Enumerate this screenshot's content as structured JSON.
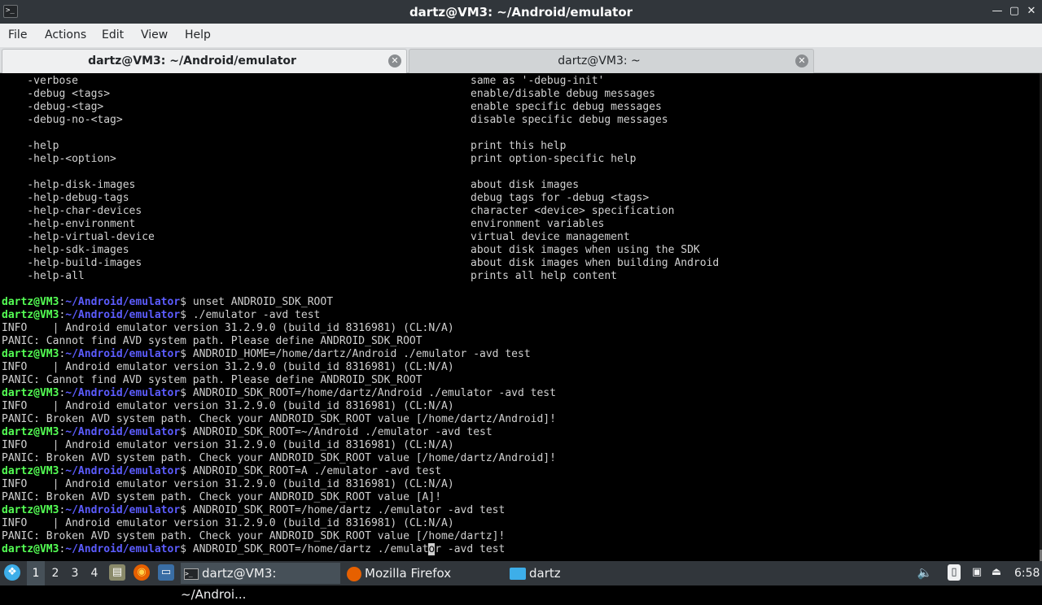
{
  "window": {
    "title": "dartz@VM3: ~/Android/emulator",
    "app_icon": "terminal-icon",
    "controls": [
      "minimize-icon",
      "maximize-icon",
      "close-icon"
    ],
    "control_glyphs": [
      "—",
      "▢",
      "✕"
    ]
  },
  "menu": [
    "File",
    "Actions",
    "Edit",
    "View",
    "Help"
  ],
  "tabs": [
    {
      "label": "dartz@VM3: ~/Android/emulator",
      "active": true
    },
    {
      "label": "dartz@VM3: ~",
      "active": false
    }
  ],
  "help_lines": [
    {
      "opt": "    -verbose",
      "desc": "same as '-debug-init'"
    },
    {
      "opt": "    -debug <tags>",
      "desc": "enable/disable debug messages"
    },
    {
      "opt": "    -debug-<tag>",
      "desc": "enable specific debug messages"
    },
    {
      "opt": "    -debug-no-<tag>",
      "desc": "disable specific debug messages"
    },
    {
      "opt": "",
      "desc": ""
    },
    {
      "opt": "    -help",
      "desc": "print this help"
    },
    {
      "opt": "    -help-<option>",
      "desc": "print option-specific help"
    },
    {
      "opt": "",
      "desc": ""
    },
    {
      "opt": "    -help-disk-images",
      "desc": "about disk images"
    },
    {
      "opt": "    -help-debug-tags",
      "desc": "debug tags for -debug <tags>"
    },
    {
      "opt": "    -help-char-devices",
      "desc": "character <device> specification"
    },
    {
      "opt": "    -help-environment",
      "desc": "environment variables"
    },
    {
      "opt": "    -help-virtual-device",
      "desc": "virtual device management"
    },
    {
      "opt": "    -help-sdk-images",
      "desc": "about disk images when using the SDK"
    },
    {
      "opt": "    -help-build-images",
      "desc": "about disk images when building Android"
    },
    {
      "opt": "    -help-all",
      "desc": "prints all help content"
    }
  ],
  "prompt": {
    "user_host": "dartz@VM3",
    "path": "~/Android/emulator",
    "symbol": "$ "
  },
  "session_lines": [
    {
      "type": "prompt",
      "cmd": "unset ANDROID_SDK_ROOT"
    },
    {
      "type": "prompt",
      "cmd": "./emulator -avd test"
    },
    {
      "type": "out",
      "text": "INFO    | Android emulator version 31.2.9.0 (build_id 8316981) (CL:N/A)"
    },
    {
      "type": "out",
      "text": "PANIC: Cannot find AVD system path. Please define ANDROID_SDK_ROOT"
    },
    {
      "type": "prompt",
      "cmd": "ANDROID_HOME=/home/dartz/Android ./emulator -avd test"
    },
    {
      "type": "out",
      "text": "INFO    | Android emulator version 31.2.9.0 (build_id 8316981) (CL:N/A)"
    },
    {
      "type": "out",
      "text": "PANIC: Cannot find AVD system path. Please define ANDROID_SDK_ROOT"
    },
    {
      "type": "prompt",
      "cmd": "ANDROID_SDK_ROOT=/home/dartz/Android ./emulator -avd test"
    },
    {
      "type": "out",
      "text": "INFO    | Android emulator version 31.2.9.0 (build_id 8316981) (CL:N/A)"
    },
    {
      "type": "out",
      "text": "PANIC: Broken AVD system path. Check your ANDROID_SDK_ROOT value [/home/dartz/Android]!"
    },
    {
      "type": "prompt",
      "cmd": "ANDROID_SDK_ROOT=~/Android ./emulator -avd test"
    },
    {
      "type": "out",
      "text": "INFO    | Android emulator version 31.2.9.0 (build_id 8316981) (CL:N/A)"
    },
    {
      "type": "out",
      "text": "PANIC: Broken AVD system path. Check your ANDROID_SDK_ROOT value [/home/dartz/Android]!"
    },
    {
      "type": "prompt",
      "cmd": "ANDROID_SDK_ROOT=A ./emulator -avd test"
    },
    {
      "type": "out",
      "text": "INFO    | Android emulator version 31.2.9.0 (build_id 8316981) (CL:N/A)"
    },
    {
      "type": "out",
      "text": "PANIC: Broken AVD system path. Check your ANDROID_SDK_ROOT value [A]!"
    },
    {
      "type": "prompt",
      "cmd": "ANDROID_SDK_ROOT=/home/dartz ./emulator -avd test"
    },
    {
      "type": "out",
      "text": "INFO    | Android emulator version 31.2.9.0 (build_id 8316981) (CL:N/A)"
    },
    {
      "type": "out",
      "text": "PANIC: Broken AVD system path. Check your ANDROID_SDK_ROOT value [/home/dartz]!"
    },
    {
      "type": "prompt_cursor",
      "cmd_before": "ANDROID_SDK_ROOT=/home/dartz ./emulat",
      "cursor_char": "o",
      "cmd_after": "r -avd test"
    }
  ],
  "taskbar": {
    "start_icon": "start-menu-icon",
    "workspaces": [
      "1",
      "2",
      "3",
      "4"
    ],
    "current_workspace": "1",
    "launchers": [
      "file-manager-icon",
      "firefox-icon",
      "desktop-icon"
    ],
    "tasks": [
      {
        "label": "dartz@VM3: ~/Androi...",
        "icon": "terminal-icon",
        "active": true
      },
      {
        "label": "Mozilla Firefox",
        "icon": "firefox-icon",
        "active": false
      },
      {
        "label": "dartz",
        "icon": "folder-icon",
        "active": false
      }
    ],
    "tray_icons": [
      "volume-icon",
      "clipboard-icon",
      "network-icon",
      "eject-icon"
    ],
    "clock": "6:58"
  },
  "colors": {
    "prompt_user": "#54ff54",
    "prompt_path": "#5c5cff",
    "terminal_bg": "#000000",
    "terminal_fg": "#d0d0d0"
  }
}
